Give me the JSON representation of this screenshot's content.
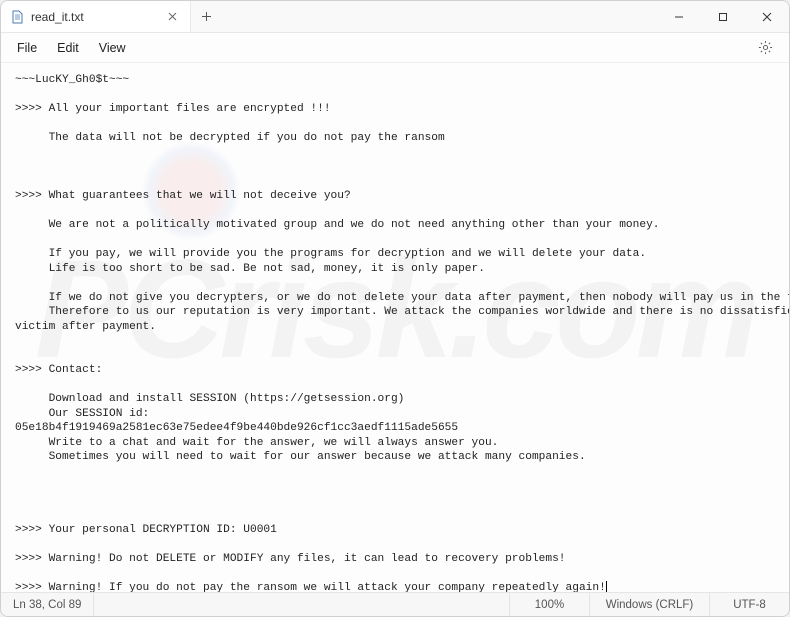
{
  "tab": {
    "title": "read_it.txt"
  },
  "menu": {
    "file": "File",
    "edit": "Edit",
    "view": "View"
  },
  "body": {
    "l1": "~~~LucKY_Gh0$t~~~",
    "l2": "",
    "l3": ">>>> All your important files are encrypted !!!",
    "l4": "",
    "l5": "     The data will not be decrypted if you do not pay the ransom",
    "l6": "",
    "l7": "",
    "l8": "",
    "l9": ">>>> What guarantees that we will not deceive you?",
    "l10": "",
    "l11": "     We are not a politically motivated group and we do not need anything other than your money.",
    "l12": "",
    "l13": "     If you pay, we will provide you the programs for decryption and we will delete your data.",
    "l14": "     Life is too short to be sad. Be not sad, money, it is only paper.",
    "l15": "",
    "l16": "     If we do not give you decrypters, or we do not delete your data after payment, then nobody will pay us in the future.",
    "l17": "     Therefore to us our reputation is very important. We attack the companies worldwide and there is no dissatisfied",
    "l18": "victim after payment.",
    "l19": "",
    "l20": "",
    "l21": ">>>> Contact:",
    "l22": "",
    "l23": "     Download and install SESSION (https://getsession.org)",
    "l24": "     Our SESSION id:",
    "l25": "05e18b4f1919469a2581ec63e75edee4f9be440bde926cf1cc3aedf1115ade5655",
    "l26": "     Write to a chat and wait for the answer, we will always answer you.",
    "l27": "     Sometimes you will need to wait for our answer because we attack many companies.",
    "l28": "",
    "l29": "",
    "l30": "",
    "l31": "",
    "l32": ">>>> Your personal DECRYPTION ID: U0001",
    "l33": "",
    "l34": ">>>> Warning! Do not DELETE or MODIFY any files, it can lead to recovery problems!",
    "l35": "",
    "l36": ">>>> Warning! If you do not pay the ransom we will attack your company repeatedly again!"
  },
  "status": {
    "position": "Ln 38, Col 89",
    "zoom": "100%",
    "lineending": "Windows (CRLF)",
    "encoding": "UTF-8"
  }
}
